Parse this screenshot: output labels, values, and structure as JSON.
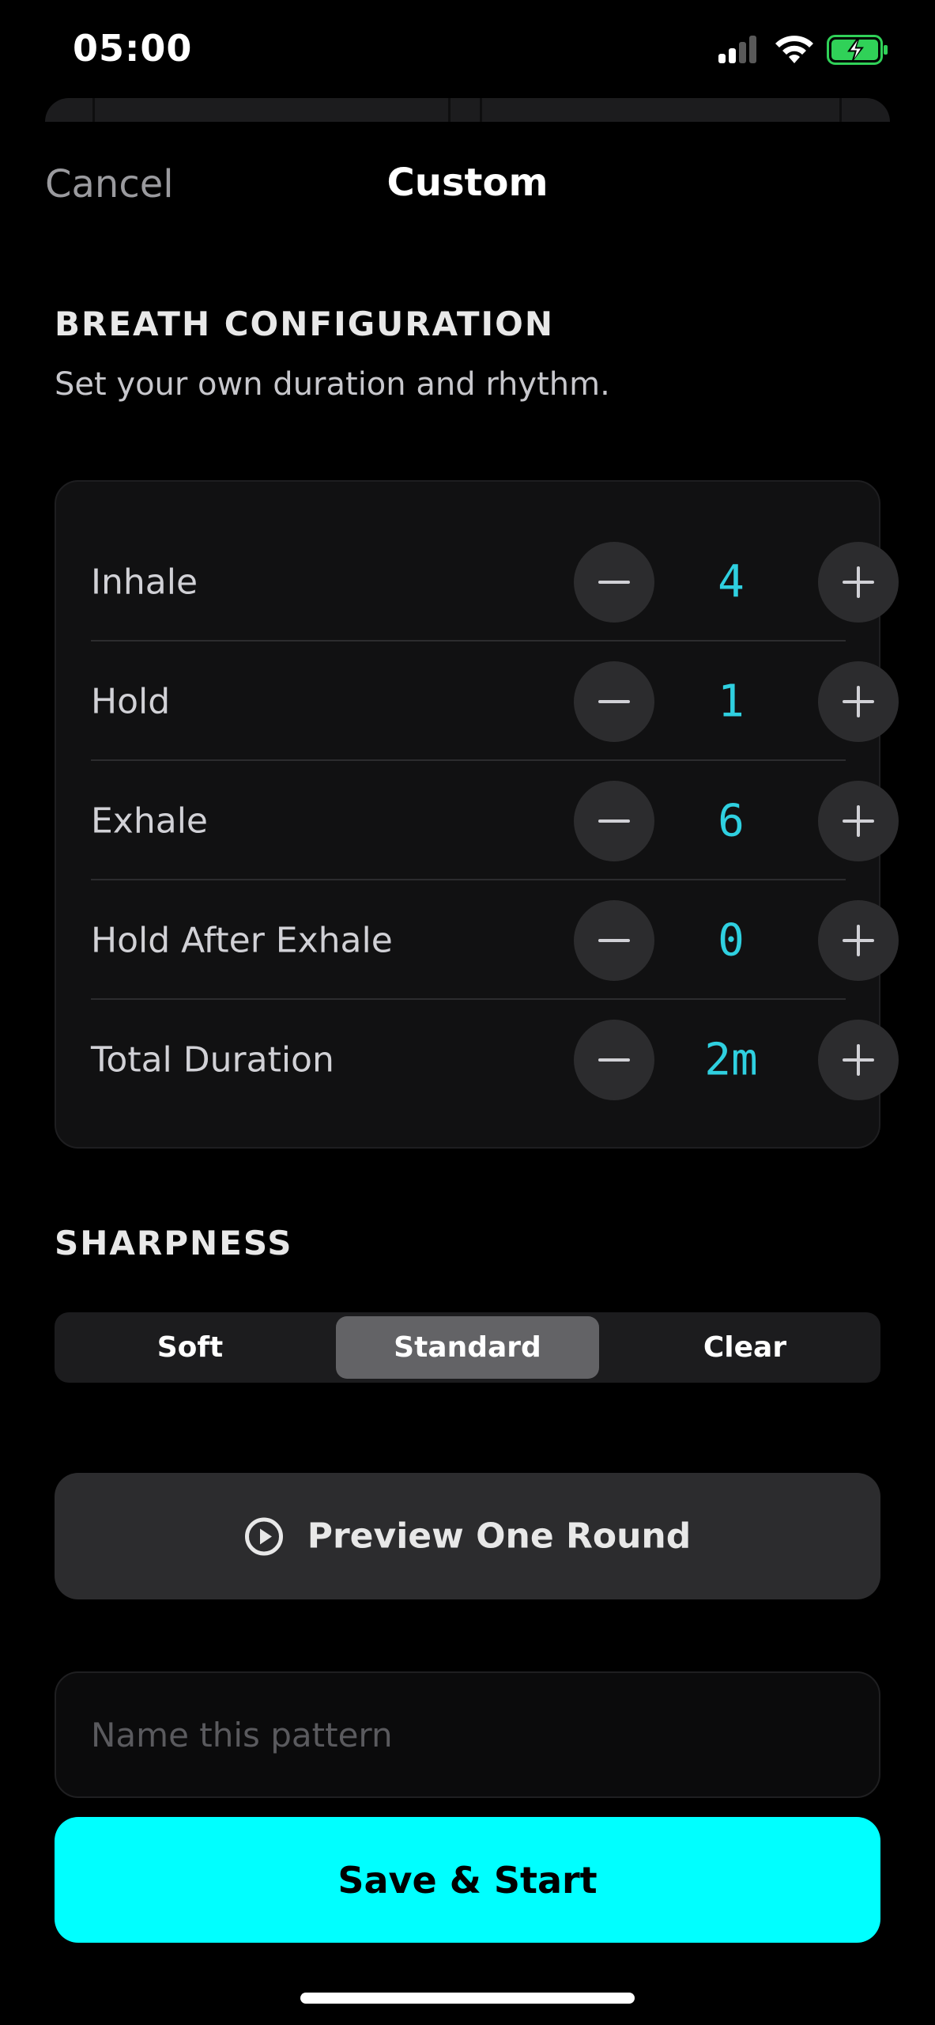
{
  "status_bar": {
    "time": "05:00",
    "icons": [
      "signal-icon",
      "wifi-icon",
      "battery-charging-icon"
    ]
  },
  "nav": {
    "cancel_label": "Cancel",
    "title": "Custom"
  },
  "breath_configuration": {
    "title": "BREATH CONFIGURATION",
    "subtitle": "Set your own duration and rhythm.",
    "rows": [
      {
        "label": "Inhale",
        "value": "4"
      },
      {
        "label": "Hold",
        "value": "1"
      },
      {
        "label": "Exhale",
        "value": "6"
      },
      {
        "label": "Hold After Exhale",
        "value": "0"
      },
      {
        "label": "Total Duration",
        "value": "2m"
      }
    ]
  },
  "sharpness": {
    "title": "SHARPNESS",
    "options": [
      "Soft",
      "Standard",
      "Clear"
    ],
    "selected": "Standard"
  },
  "preview": {
    "label": "Preview One Round",
    "icon": "play-circle-icon"
  },
  "name_field": {
    "placeholder": "Name this pattern",
    "value": ""
  },
  "save": {
    "label": "Save & Start"
  },
  "colors": {
    "accent": "#00ffff",
    "value_text": "#2fd0e0",
    "battery": "#30d158"
  }
}
